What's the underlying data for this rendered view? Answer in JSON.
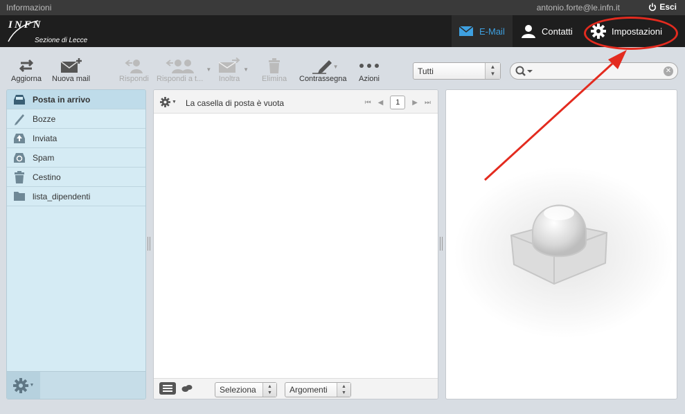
{
  "topbar": {
    "info": "Informazioni",
    "user": "antonio.forte@le.infn.it",
    "logout": "Esci"
  },
  "logo": {
    "name": "INFN",
    "subtitle": "Sezione di Lecce"
  },
  "nav": {
    "mail": "E-Mail",
    "contacts": "Contatti",
    "settings": "Impostazioni"
  },
  "toolbar": {
    "refresh": "Aggiorna",
    "compose": "Nuova mail",
    "reply": "Rispondi",
    "reply_all": "Rispondi a t...",
    "forward": "Inoltra",
    "delete": "Elimina",
    "mark": "Contrassegna",
    "more": "Azioni"
  },
  "filter": {
    "value": "Tutti"
  },
  "folders": [
    {
      "label": "Posta in arrivo",
      "icon": "inbox-icon"
    },
    {
      "label": "Bozze",
      "icon": "pencil-icon"
    },
    {
      "label": "Inviata",
      "icon": "sent-icon"
    },
    {
      "label": "Spam",
      "icon": "spam-icon"
    },
    {
      "label": "Cestino",
      "icon": "trash-icon"
    },
    {
      "label": "lista_dipendenti",
      "icon": "folder-icon"
    }
  ],
  "messagelist": {
    "status": "La casella di posta è vuota",
    "page": "1",
    "select_label": "Seleziona",
    "threads_label": "Argomenti"
  },
  "colors": {
    "accent": "#3ea0e0",
    "highlight": "#e32b1f",
    "folder_bg": "#d5ebf4"
  }
}
